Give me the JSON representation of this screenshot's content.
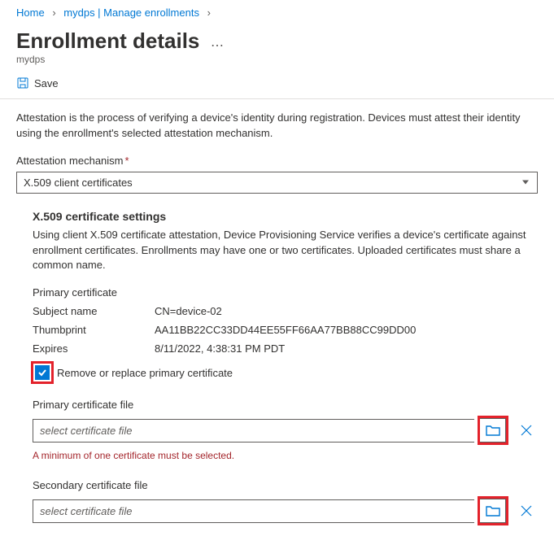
{
  "breadcrumb": {
    "home": "Home",
    "path": "mydps | Manage enrollments"
  },
  "header": {
    "title": "Enrollment details",
    "subtitle": "mydps"
  },
  "toolbar": {
    "save_label": "Save"
  },
  "description": "Attestation is the process of verifying a device's identity during registration. Devices must attest their identity using the enrollment's selected attestation mechanism.",
  "attestation": {
    "label": "Attestation mechanism",
    "value": "X.509 client certificates"
  },
  "x509": {
    "heading": "X.509 certificate settings",
    "desc": "Using client X.509 certificate attestation, Device Provisioning Service verifies a device's certificate against enrollment certificates. Enrollments may have one or two certificates. Uploaded certificates must share a common name.",
    "primary_heading": "Primary certificate",
    "rows": {
      "subject_name_label": "Subject name",
      "subject_name_value": "CN=device-02",
      "thumbprint_label": "Thumbprint",
      "thumbprint_value": "AA11BB22CC33DD44EE55FF66AA77BB88CC99DD00",
      "expires_label": "Expires",
      "expires_value": "8/11/2022, 4:38:31 PM PDT"
    },
    "remove_replace_label": "Remove or replace primary certificate",
    "remove_replace_checked": true,
    "primary_file": {
      "label": "Primary certificate file",
      "placeholder": "select certificate file"
    },
    "error": "A minimum of one certificate must be selected.",
    "secondary_file": {
      "label": "Secondary certificate file",
      "placeholder": "select certificate file"
    }
  }
}
